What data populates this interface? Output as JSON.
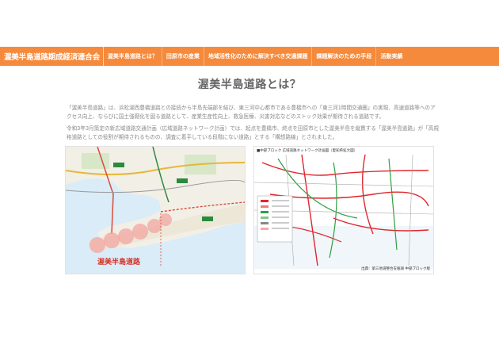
{
  "navbar": {
    "brand": "渥美半島道路期成経済連合会",
    "items": [
      {
        "label": "渥美半島道路とは？"
      },
      {
        "label": "田原市の産業"
      },
      {
        "label": "地域活性化のために解決すべき交通課題"
      },
      {
        "label": "課題解決のための手段"
      },
      {
        "label": "活動実績"
      }
    ],
    "color": "#f58a3c"
  },
  "main": {
    "title": "渥美半島道路とは？",
    "paragraph1": "「渥美半島道路」は、浜松湖西豊橋道路との接続から半島先端部を結び、東三河中心都市である豊橋市への「東三河1時間交通圏」の実現、高速道路等へのアクセス向上、ならびに国土強靭化を図る道路として、産業生産性向上、救急医療、災害対応などのストック効果が期待される道路です。",
    "paragraph2": "令和3年3月策定の新広域道路交通計画（広域道路ネットワーク計画）では、起点を豊橋市、終点を田原市とした渥美半島を縦貫する「渥美半島道路」が「高規格道路としての役割が期待されるものの、調査に着手している段階にない道路」とする「構想路線」とされました。"
  },
  "figures": {
    "left_map_label": "渥美半島道路",
    "right_map_caption": "■中部ブロック 広域道路ネットワーク計画図（愛知県拡大図）",
    "right_map_source": "出典：第三地道整合支援調 中部ブロック版"
  }
}
